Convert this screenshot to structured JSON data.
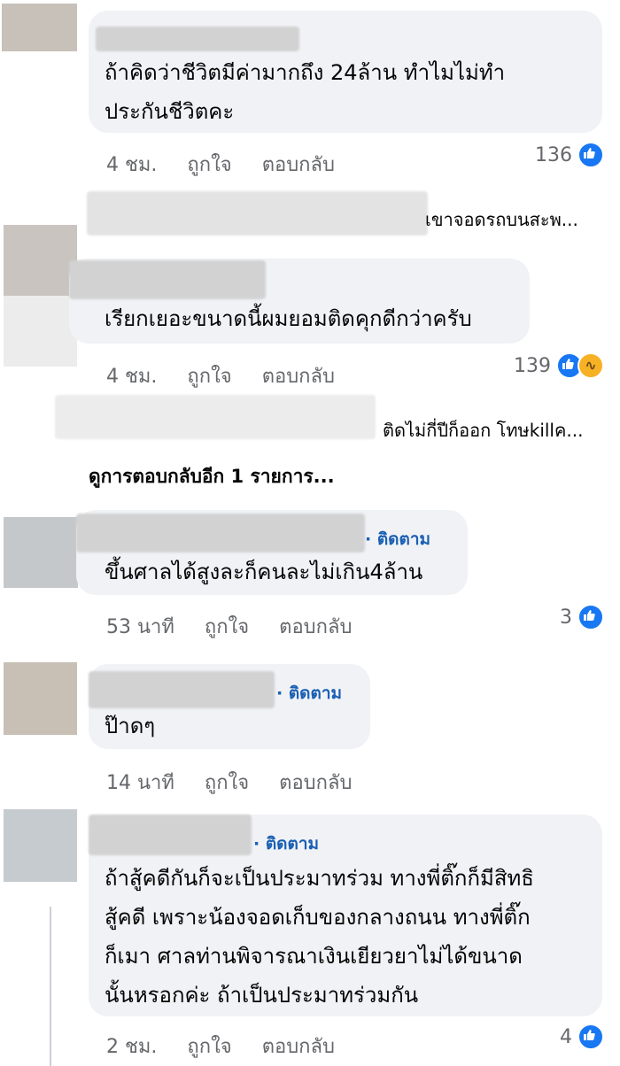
{
  "comments": [
    {
      "text_lines": [
        "ถ้าคิดว่าชีวิตมีค่ามากถึง 24ล้าน ทำไมไม่ทำ",
        "ประกันชีวิตคะ"
      ],
      "time": "4 ชม.",
      "like_label": "ถูกใจ",
      "reply_label": "ตอบกลับ",
      "reaction_count": "136",
      "reaction_icons": [
        "like-icon"
      ]
    },
    {
      "preview_text": "เขาจอดรถบนสะพ...",
      "text_lines": [
        "เรียกเยอะขนาดนี้ผมยอมติดคุกดีกว่าครับ"
      ],
      "time": "4 ชม.",
      "like_label": "ถูกใจ",
      "reply_label": "ตอบกลับ",
      "reaction_count": "139",
      "reaction_icons": [
        "like-icon",
        "haha-icon"
      ],
      "reply_preview_text": "ติดไม่กี่ปีก็ออก โทษkillค...",
      "more_replies": "ดูการตอบกลับอีก 1 รายการ..."
    },
    {
      "follow": "· ติดตาม",
      "text_lines": [
        "ขึ้นศาลได้สูงละก็คนละไม่เกิน4ล้าน"
      ],
      "time": "53 นาที",
      "like_label": "ถูกใจ",
      "reply_label": "ตอบกลับ",
      "reaction_count": "3",
      "reaction_icons": [
        "like-icon"
      ]
    },
    {
      "follow": "· ติดตาม",
      "text_lines": [
        "ป๊าดๆ"
      ],
      "time": "14 นาที",
      "like_label": "ถูกใจ",
      "reply_label": "ตอบกลับ"
    },
    {
      "follow": "· ติดตาม",
      "text_lines": [
        "ถ้าสู้คดีกันก็จะเป็นประมาทร่วม ทางพี่ติ๊กก็มีสิทธิ",
        "สู้คดี เพราะน้องจอดเก็บของกลางถนน ทางพี่ติ๊ก",
        "ก็เมา ศาลท่านพิจารณาเงินเยียวยาไม่ได้ขนาด",
        "นั้นหรอกค่ะ ถ้าเป็นประมาทร่วมกัน"
      ],
      "time": "2 ชม.",
      "like_label": "ถูกใจ",
      "reply_label": "ตอบกลับ",
      "reaction_count": "4",
      "reaction_icons": [
        "like-icon"
      ]
    }
  ],
  "colors": {
    "accent": "#1a5fb4",
    "bubble": "#f0f2f5",
    "meta": "#65676b",
    "like": "#1877f2",
    "haha": "#f7b125"
  }
}
